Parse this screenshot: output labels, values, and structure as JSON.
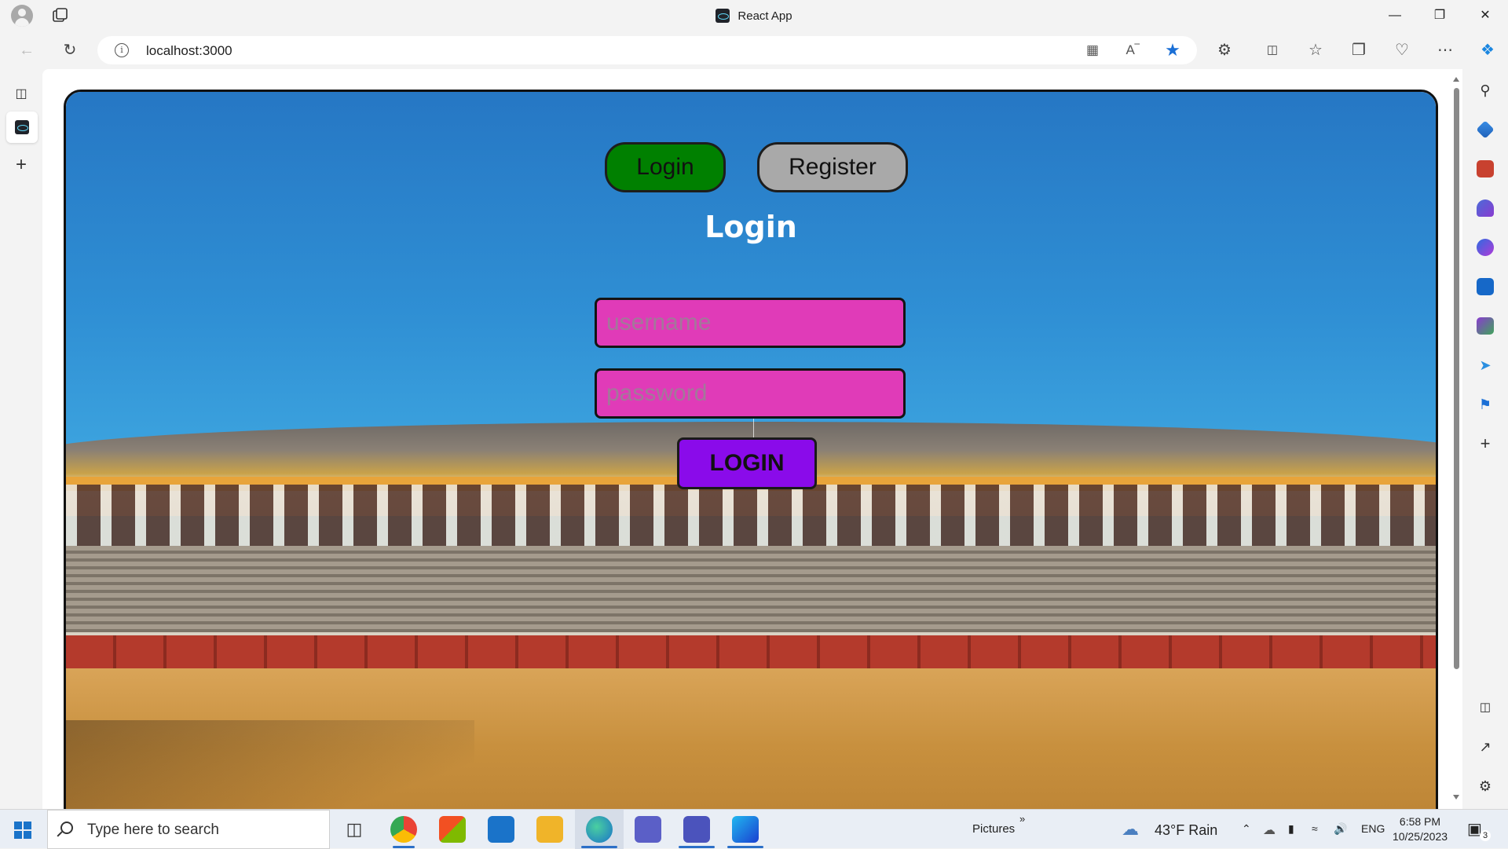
{
  "window": {
    "title": "React App"
  },
  "addressbar": {
    "url": "localhost:3000"
  },
  "page": {
    "tabs": {
      "login_label": "Login",
      "register_label": "Register"
    },
    "form": {
      "title": "Login",
      "username_placeholder": "username",
      "password_placeholder": "password",
      "submit_label": "LOGIN"
    },
    "colors": {
      "login_tab": "#008000",
      "register_tab": "#a9a9a9",
      "input_bg": "#e03bb8",
      "submit_bg": "#8a0bea"
    }
  },
  "taskbar": {
    "search_placeholder": "Type here to search",
    "pictures_label": "Pictures",
    "weather": "43°F  Rain",
    "language": "ENG",
    "time": "6:58 PM",
    "date": "10/25/2023",
    "notification_count": "3"
  },
  "icons": {
    "browser": [
      "profile-icon",
      "workspaces-icon",
      "back-icon",
      "refresh-icon",
      "info-icon",
      "app-available-icon",
      "read-aloud-icon",
      "favorite-star-icon",
      "extensions-icon",
      "split-screen-icon",
      "favorites-icon",
      "collections-icon",
      "browser-essentials-icon",
      "more-icon",
      "copilot-icon"
    ],
    "sidebar": [
      "search-icon",
      "shopping-icon",
      "tools-icon",
      "games-icon",
      "microsoft365-icon",
      "outlook-icon",
      "designer-icon",
      "send-icon",
      "feedback-icon",
      "add-icon",
      "sidebar-toggle-icon",
      "open-external-icon",
      "settings-icon"
    ]
  }
}
